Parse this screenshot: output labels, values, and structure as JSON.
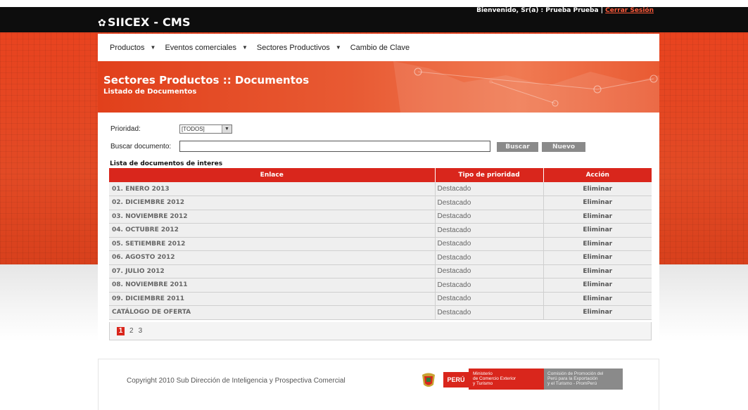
{
  "header": {
    "logo": "SIICEX - CMS",
    "welcome": "Bienvenido, Sr(a) : Prueba Prueba",
    "separator": "|",
    "logout": "Cerrar Sesión"
  },
  "menu": [
    {
      "label": "Productos",
      "has_dropdown": true
    },
    {
      "label": "Eventos comerciales",
      "has_dropdown": true
    },
    {
      "label": "Sectores Productivos",
      "has_dropdown": true
    },
    {
      "label": "Cambio de Clave",
      "has_dropdown": false
    }
  ],
  "hero": {
    "title": "Sectores Productos :: Documentos",
    "subtitle": "Listado de Documentos"
  },
  "filters": {
    "priority_label": "Prioridad:",
    "priority_value": "[TODOS]",
    "search_label": "Buscar documento:",
    "search_value": "",
    "search_button": "Buscar",
    "new_button": "Nuevo"
  },
  "list": {
    "title": "Lista de documentos de interes",
    "columns": [
      "Enlace",
      "Tipo de prioridad",
      "Acción"
    ],
    "rows": [
      {
        "enlace": "01. ENERO 2013",
        "tipo": "Destacado",
        "accion": "Eliminar"
      },
      {
        "enlace": "02. DICIEMBRE 2012",
        "tipo": "Destacado",
        "accion": "Eliminar"
      },
      {
        "enlace": "03. NOVIEMBRE 2012",
        "tipo": "Destacado",
        "accion": "Eliminar"
      },
      {
        "enlace": "04. OCTUBRE 2012",
        "tipo": "Destacado",
        "accion": "Eliminar"
      },
      {
        "enlace": "05. SETIEMBRE 2012",
        "tipo": "Destacado",
        "accion": "Eliminar"
      },
      {
        "enlace": "06. AGOSTO 2012",
        "tipo": "Destacado",
        "accion": "Eliminar"
      },
      {
        "enlace": "07. JULIO 2012",
        "tipo": "Destacado",
        "accion": "Eliminar"
      },
      {
        "enlace": "08. NOVIEMBRE 2011",
        "tipo": "Destacado",
        "accion": "Eliminar"
      },
      {
        "enlace": "09. DICIEMBRE 2011",
        "tipo": "Destacado",
        "accion": "Eliminar"
      },
      {
        "enlace": "CATÁLOGO DE OFERTA",
        "tipo": "Destacado",
        "accion": "Eliminar"
      }
    ],
    "pages": [
      "1",
      "2",
      "3"
    ],
    "current_page": "1"
  },
  "footer": {
    "copyright": "Copyright 2010 Sub Dirección de Inteligencia y Prospectiva Comercial",
    "peru": "PERÚ",
    "ministerio": [
      "Ministerio",
      "de Comercio Exterior",
      "y Turismo"
    ],
    "promperu": [
      "Comisión de Promoción del",
      "Perú para la Exportación",
      "y el Turismo - PromPerú"
    ]
  },
  "colors": {
    "brand_red": "#d9261c",
    "header_black": "#0d0d0d",
    "button_gray": "#8a8a8a"
  }
}
